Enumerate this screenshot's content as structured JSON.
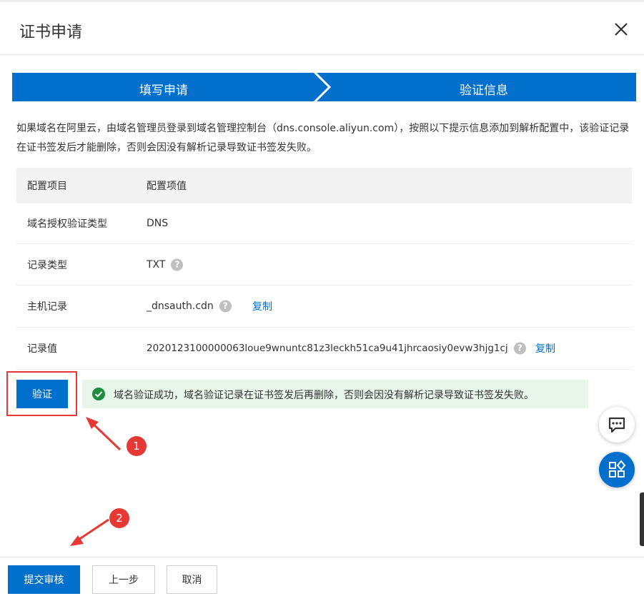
{
  "dialog": {
    "title": "证书申请"
  },
  "steps": [
    {
      "label": "填写申请"
    },
    {
      "label": "验证信息"
    }
  ],
  "description": "如果域名在阿里云，由域名管理员登录到域名管理控制台（dns.console.aliyun.com），按照以下提示信息添加到解析配置中，该验证记录在证书签发后才能删除，否则会因没有解析记录导致证书签发失败。",
  "table": {
    "headers": [
      "配置项目",
      "配置项值"
    ],
    "rows": [
      {
        "label": "域名授权验证类型",
        "value": "DNS"
      },
      {
        "label": "记录类型",
        "value": "TXT"
      },
      {
        "label": "主机记录",
        "value": "_dnsauth.cdn",
        "copy": "复制"
      },
      {
        "label": "记录值",
        "value": "2020123100000063loue9wnuntc81z3leckh51ca9u41jhrcaosiy0evw3hjg1cj",
        "copy": "复制"
      }
    ]
  },
  "verify": {
    "button_label": "验证",
    "success_message": "域名验证成功，域名验证记录在证书签发后再删除，否则会因没有解析记录导致证书签发失败。"
  },
  "annotations": {
    "badge1": "1",
    "badge2": "2"
  },
  "footer": {
    "submit_label": "提交审核",
    "prev_label": "上一步",
    "cancel_label": "取消"
  },
  "colors": {
    "primary": "#0070cc",
    "success_bg": "#e8f5e9",
    "success_icon": "#1e8e3e",
    "annotation_red": "#e53935"
  },
  "icons": {
    "close": "close-icon",
    "help": "question-circle-icon",
    "success": "check-circle-icon",
    "chat": "chat-icon",
    "apps": "apps-icon"
  }
}
